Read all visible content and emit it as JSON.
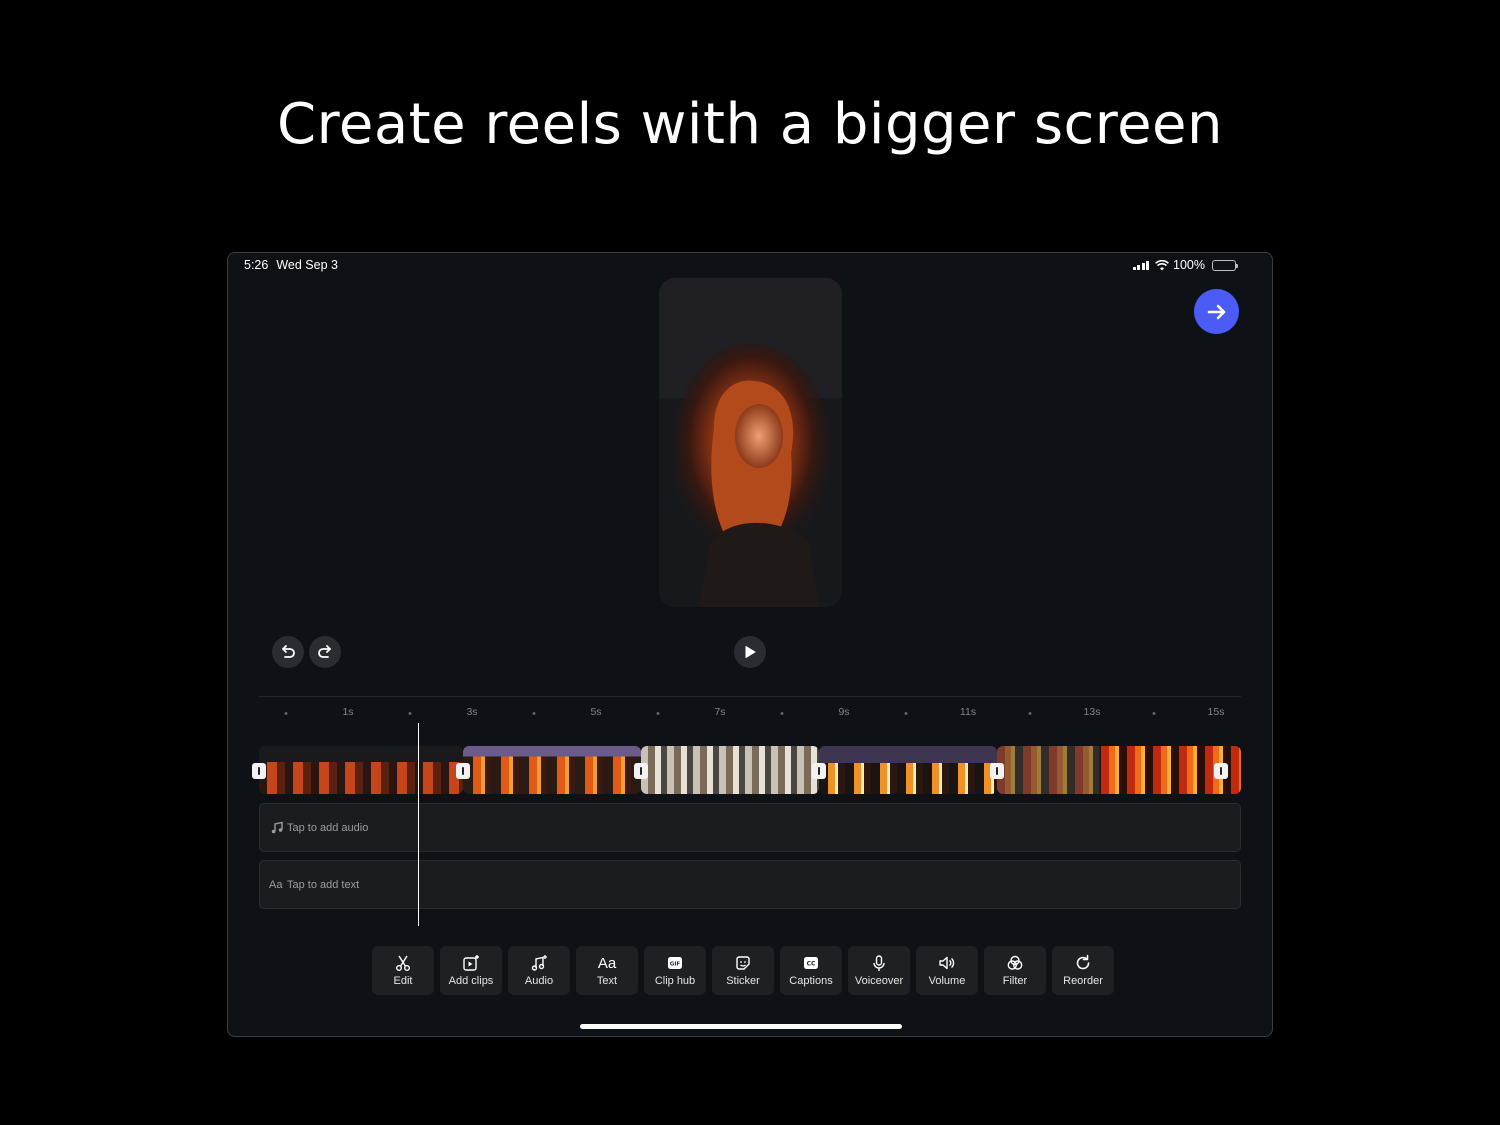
{
  "headline": "Create reels with a bigger screen",
  "status_bar": {
    "time": "5:26",
    "date": "Wed Sep 3",
    "battery": "100%"
  },
  "next_button": {
    "icon": "arrow-right-icon",
    "color": "#4a5cf5"
  },
  "controls": {
    "undo_icon": "undo-icon",
    "redo_icon": "redo-icon",
    "play_icon": "play-icon"
  },
  "timeline": {
    "ticks": [
      "1s",
      "3s",
      "5s",
      "7s",
      "9s",
      "11s",
      "13s",
      "15s"
    ],
    "clips": [
      {
        "style": "fire"
      },
      {
        "style": "sunset-fire"
      },
      {
        "style": "portrait-bright"
      },
      {
        "style": "night-fire"
      },
      {
        "style": "flames"
      }
    ]
  },
  "tracks": {
    "audio": {
      "icon": "music-note-icon",
      "label": "Tap to add audio"
    },
    "text": {
      "icon": "text-aa-icon",
      "label": "Tap to add text"
    }
  },
  "toolbar": [
    {
      "id": "edit",
      "label": "Edit",
      "icon": "scissors-icon"
    },
    {
      "id": "add-clips",
      "label": "Add clips",
      "icon": "add-clip-icon"
    },
    {
      "id": "audio",
      "label": "Audio",
      "icon": "music-note-icon"
    },
    {
      "id": "text",
      "label": "Text",
      "icon": "text-aa-icon"
    },
    {
      "id": "clip-hub",
      "label": "Clip hub",
      "icon": "gif-icon"
    },
    {
      "id": "sticker",
      "label": "Sticker",
      "icon": "sticker-icon"
    },
    {
      "id": "captions",
      "label": "Captions",
      "icon": "cc-icon"
    },
    {
      "id": "voiceover",
      "label": "Voiceover",
      "icon": "microphone-icon"
    },
    {
      "id": "volume",
      "label": "Volume",
      "icon": "speaker-icon"
    },
    {
      "id": "filter",
      "label": "Filter",
      "icon": "filter-circles-icon"
    },
    {
      "id": "reorder",
      "label": "Reorder",
      "icon": "rotate-icon"
    }
  ]
}
